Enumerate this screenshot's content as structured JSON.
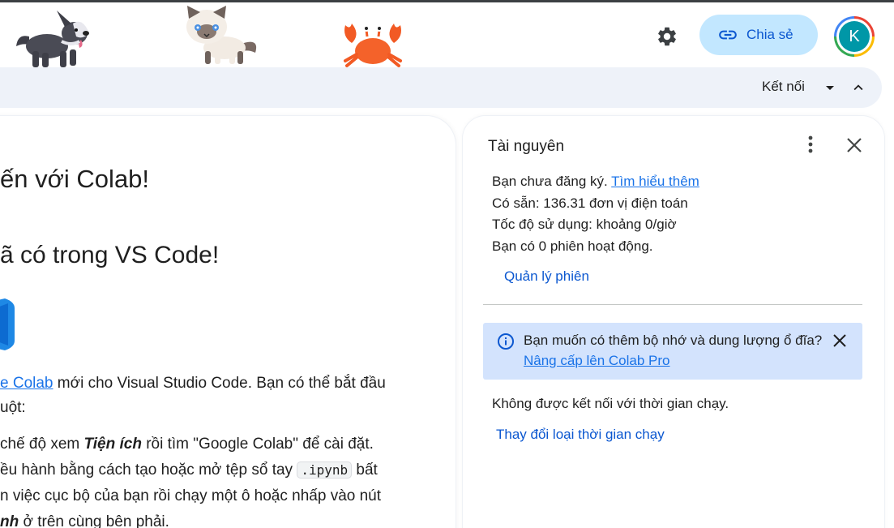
{
  "header": {
    "share_label": "Chia sẻ",
    "avatar_initial": "K",
    "icons": {
      "settings": "gear-icon",
      "share": "link-icon"
    }
  },
  "toolbar": {
    "connect_label": "Kết nối"
  },
  "notebook": {
    "heading1": "ến với Colab!",
    "heading2": "ã có trong VS Code!",
    "para_link": "e Colab",
    "para_rest": " mới cho Visual Studio Code. Bạn có thể bắt đầu",
    "para_line2": "uột:",
    "list_line1_pre": " chế độ xem ",
    "list_line1_em": "Tiện ích",
    "list_line1_post": " rồi tìm \"Google Colab\" để cài đặt.",
    "list_line2_pre": "ều hành bằng cách tạo hoặc mở tệp sổ tay ",
    "list_line2_code": ".ipynb",
    "list_line2_post": " bất",
    "list_line3": "n việc cục bộ của bạn rồi chạy một ô hoặc nhấp vào nút",
    "list_line4_em": "nh",
    "list_line4_post": " ở trên cùng bên phải."
  },
  "resources": {
    "title": "Tài nguyên",
    "not_subscribed": "Bạn chưa đăng ký.",
    "learn_more": "Tìm hiểu thêm",
    "available": "Có sẵn: 136.31 đơn vị điện toán",
    "usage_rate": "Tốc độ sử dụng: khoảng 0/giờ",
    "active_sessions": "Bạn có 0 phiên hoạt động.",
    "manage_sessions": "Quản lý phiên",
    "banner_text": "Bạn muốn có thêm bộ nhớ và dung lượng ổ đĩa?",
    "banner_link": "Nâng cấp lên Colab Pro",
    "runtime_status": "Không được kết nối với thời gian chạy.",
    "change_runtime": "Thay đổi loại thời gian chạy"
  },
  "colors": {
    "share_bg": "#c2e7ff",
    "accent": "#0b57d0",
    "link": "#1a73e8",
    "banner_bg": "#d3e3fd",
    "toolbar_bg": "#eef2f9",
    "avatar_bg": "#0097a7"
  }
}
